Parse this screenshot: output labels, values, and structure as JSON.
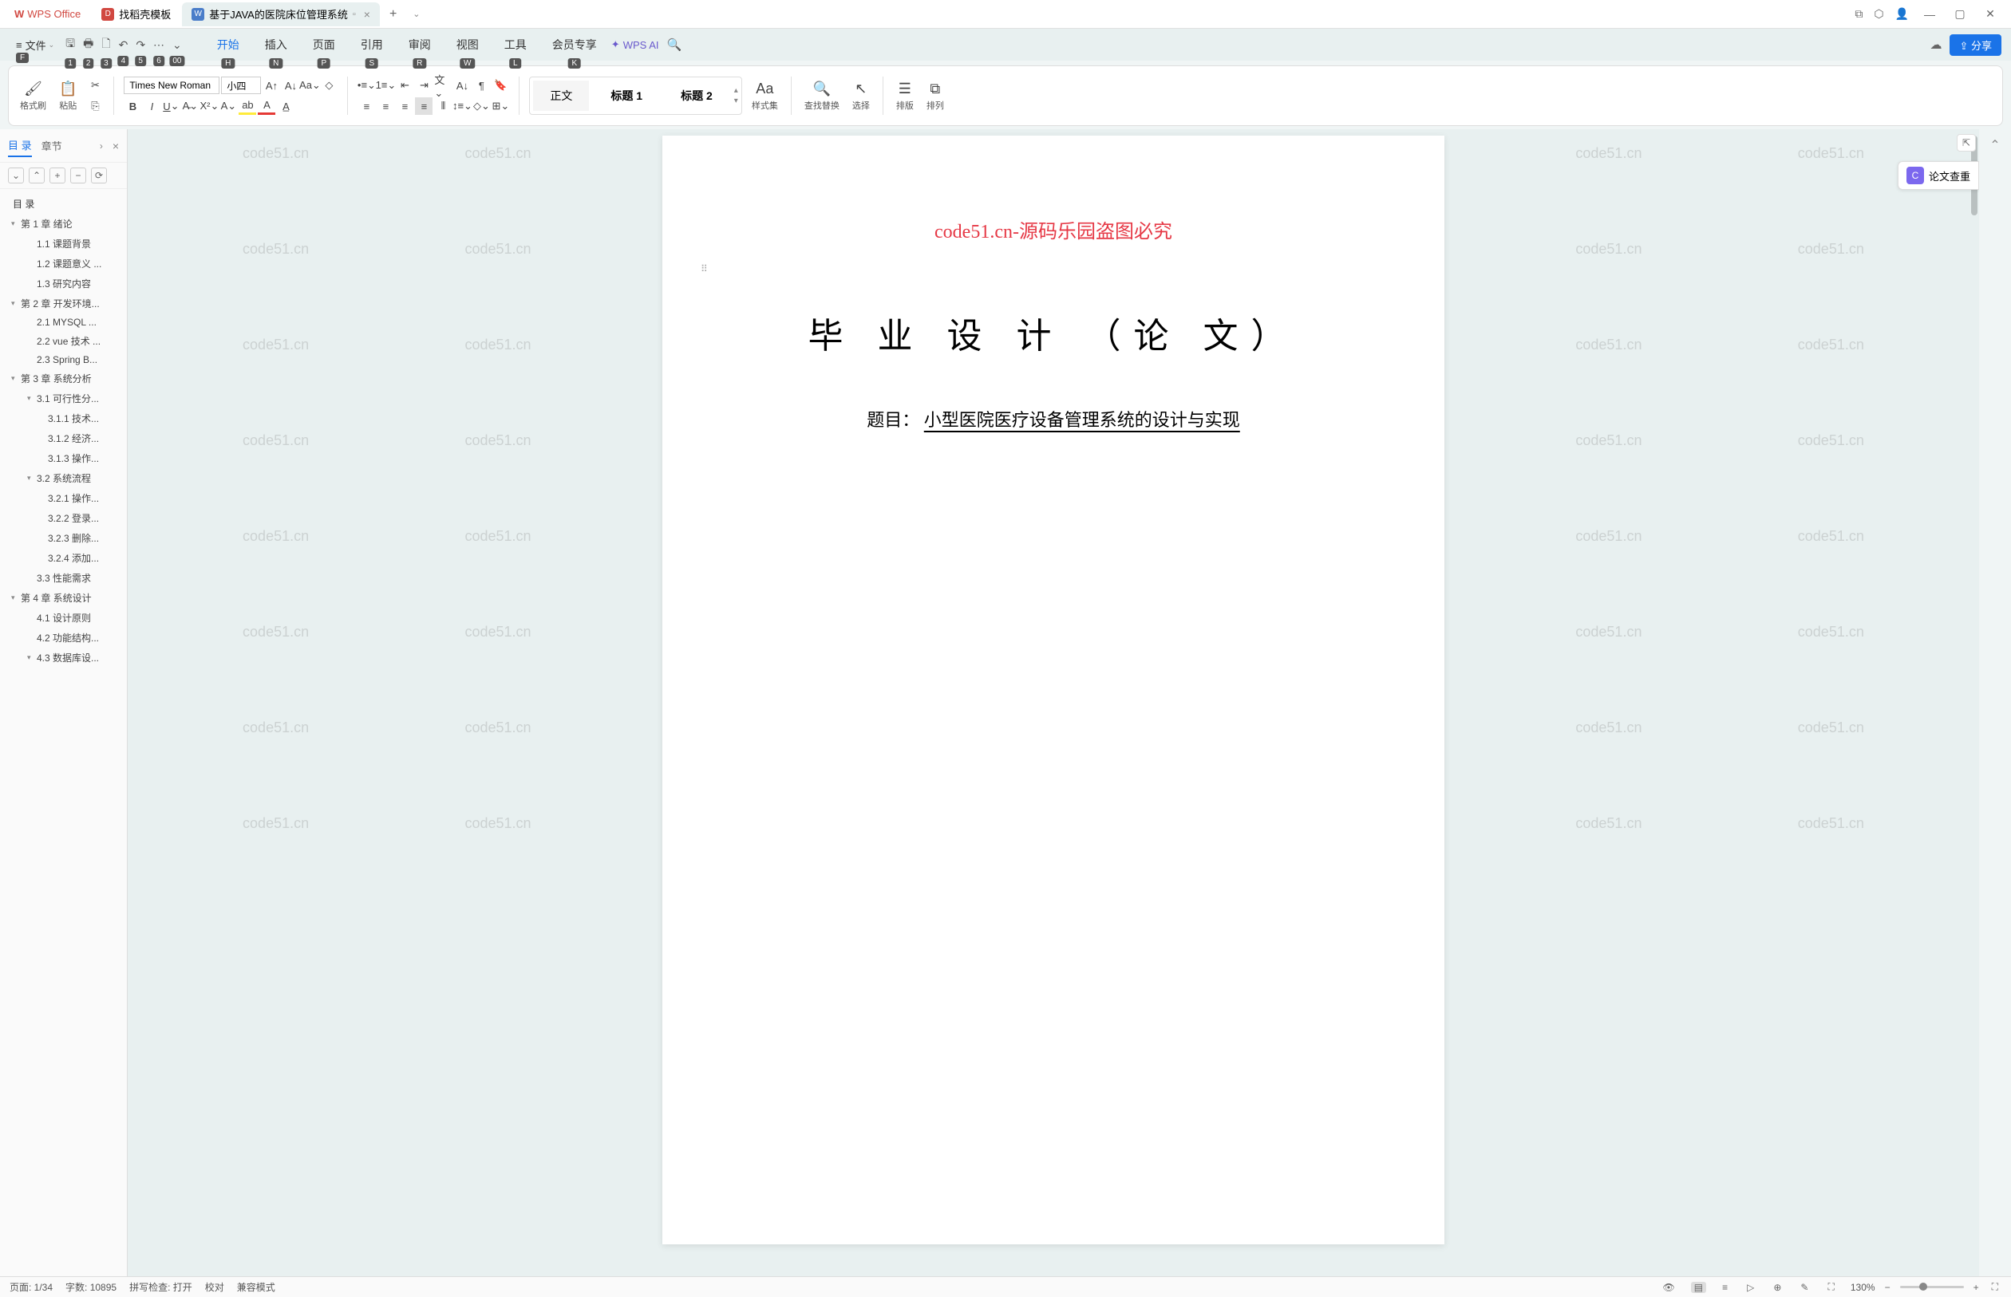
{
  "titlebar": {
    "app_tab": "WPS Office",
    "template_tab": "找稻壳模板",
    "doc_tab": "基于JAVA的医院床位管理系统"
  },
  "menubar": {
    "file": "文件",
    "items": [
      {
        "label": "开始",
        "key": "H",
        "active": true
      },
      {
        "label": "插入",
        "key": "N"
      },
      {
        "label": "页面",
        "key": "P"
      },
      {
        "label": "引用",
        "key": "S"
      },
      {
        "label": "审阅",
        "key": "R"
      },
      {
        "label": "视图",
        "key": "W"
      },
      {
        "label": "工具",
        "key": "L"
      },
      {
        "label": "会员专享",
        "key": "K"
      }
    ],
    "file_key": "F",
    "quick_keys": [
      "1",
      "2",
      "3",
      "4",
      "5",
      "6",
      "00"
    ],
    "wps_ai": "WPS AI",
    "share": "分享"
  },
  "ribbon": {
    "format_painter": "格式刷",
    "paste": "粘贴",
    "font_name": "Times New Roman",
    "font_size": "小四",
    "styles": {
      "body": "正文",
      "h1": "标题 1",
      "h2": "标题 2"
    },
    "style_set": "样式集",
    "find_replace": "查找替换",
    "select": "选择",
    "arrange_v": "排版",
    "arrange_h": "排列"
  },
  "sidebar": {
    "tabs": {
      "toc": "目 录",
      "chapter": "章节"
    },
    "toc_header": "目  录",
    "items": [
      {
        "lvl": 1,
        "label": "第 1 章  绪论",
        "caret": true
      },
      {
        "lvl": 2,
        "label": "1.1  课题背景"
      },
      {
        "lvl": 2,
        "label": "1.2  课题意义 ..."
      },
      {
        "lvl": 2,
        "label": "1.3  研究内容"
      },
      {
        "lvl": 1,
        "label": "第 2 章  开发环境...",
        "caret": true
      },
      {
        "lvl": 2,
        "label": "2.1 MYSQL ..."
      },
      {
        "lvl": 2,
        "label": "2.2 vue 技术 ..."
      },
      {
        "lvl": 2,
        "label": "2.3 Spring B..."
      },
      {
        "lvl": 1,
        "label": "第 3 章  系统分析",
        "caret": true
      },
      {
        "lvl": 2,
        "label": "3.1  可行性分...",
        "caret": true
      },
      {
        "lvl": 3,
        "label": "3.1.1  技术..."
      },
      {
        "lvl": 3,
        "label": "3.1.2  经济..."
      },
      {
        "lvl": 3,
        "label": "3.1.3  操作..."
      },
      {
        "lvl": 2,
        "label": "3.2  系统流程",
        "caret": true
      },
      {
        "lvl": 3,
        "label": "3.2.1  操作..."
      },
      {
        "lvl": 3,
        "label": "3.2.2  登录..."
      },
      {
        "lvl": 3,
        "label": "3.2.3  删除..."
      },
      {
        "lvl": 3,
        "label": "3.2.4  添加..."
      },
      {
        "lvl": 2,
        "label": "3.3  性能需求"
      },
      {
        "lvl": 1,
        "label": "第 4 章  系统设计",
        "caret": true
      },
      {
        "lvl": 2,
        "label": "4.1  设计原则"
      },
      {
        "lvl": 2,
        "label": "4.2  功能结构..."
      },
      {
        "lvl": 2,
        "label": "4.3  数据库设...",
        "caret": true
      }
    ]
  },
  "document": {
    "watermark_red": "code51.cn-源码乐园盗图必究",
    "title": "毕 业 设 计 （论 文）",
    "subject_label": "题目：",
    "subject_value": "小型医院医疗设备管理系统的设计与实现",
    "bg_watermark": "code51.cn"
  },
  "right_panel": {
    "plagiarism": "论文查重"
  },
  "statusbar": {
    "page": "页面: 1/34",
    "words": "字数: 10895",
    "spell": "拼写检查: 打开",
    "proof": "校对",
    "compat": "兼容模式",
    "zoom": "130%"
  }
}
